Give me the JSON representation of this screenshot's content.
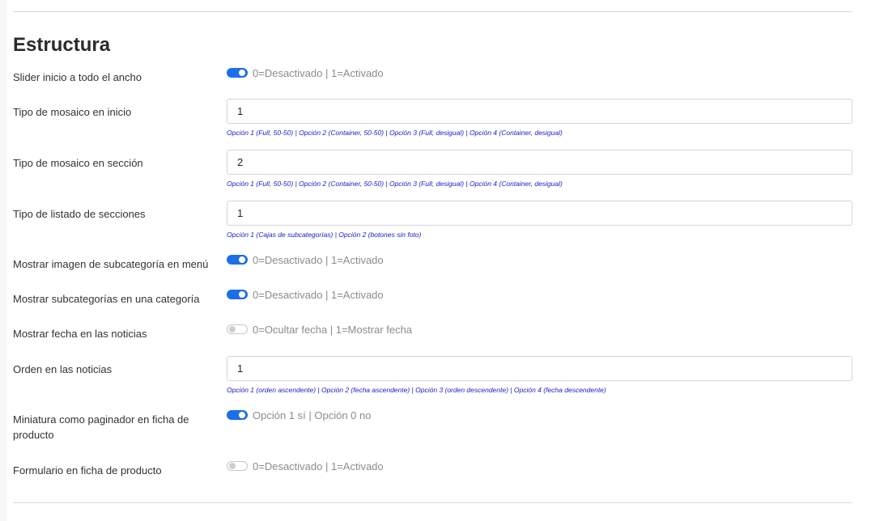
{
  "section": {
    "title": "Estructura"
  },
  "fields": [
    {
      "label": "Slider inicio a todo el ancho",
      "type": "switch",
      "on": true,
      "text": "0=Desactivado | 1=Activado"
    },
    {
      "label": "Tipo de mosaico en inicio",
      "type": "input",
      "value": "1",
      "help": "Opción 1 (Full, 50-50) | Opción 2 (Container, 50-50) | Opción 3 (Full, desigual) | Opción 4 (Container, desigual)"
    },
    {
      "label": "Tipo de mosaico en sección",
      "type": "input",
      "value": "2",
      "help": "Opción 1 (Full, 50-50) | Opción 2 (Container, 50-50) | Opción 3 (Full, desigual) | Opción 4 (Container, desigual)"
    },
    {
      "label": "Tipo de listado de secciones",
      "type": "input",
      "value": "1",
      "help": "Opción 1 (Cajas de subcategorías) | Opción 2 (botones sin foto)"
    },
    {
      "label": "Mostrar imagen de subcategoría en menú",
      "type": "switch",
      "on": true,
      "text": "0=Desactivado | 1=Activado"
    },
    {
      "label": "Mostrar subcategorías en una categoría",
      "type": "switch",
      "on": true,
      "text": "0=Desactivado | 1=Activado"
    },
    {
      "label": "Mostrar fecha en las noticias",
      "type": "switch",
      "on": false,
      "text": "0=Ocultar fecha | 1=Mostrar fecha"
    },
    {
      "label": "Orden en las noticias",
      "type": "input",
      "value": "1",
      "help": "Opción 1 (orden ascendente) | Opción 2 (fecha ascendente) | Opción 3 (orden descendente) | Opción 4 (fecha descendente)"
    },
    {
      "label": "Miniatura como paginador en ficha de producto",
      "type": "switch",
      "on": true,
      "text": "Opción 1 sí | Opción 0 no"
    },
    {
      "label": "Formulario en ficha de producto",
      "type": "switch",
      "on": false,
      "text": "0=Desactivado | 1=Activado"
    }
  ]
}
